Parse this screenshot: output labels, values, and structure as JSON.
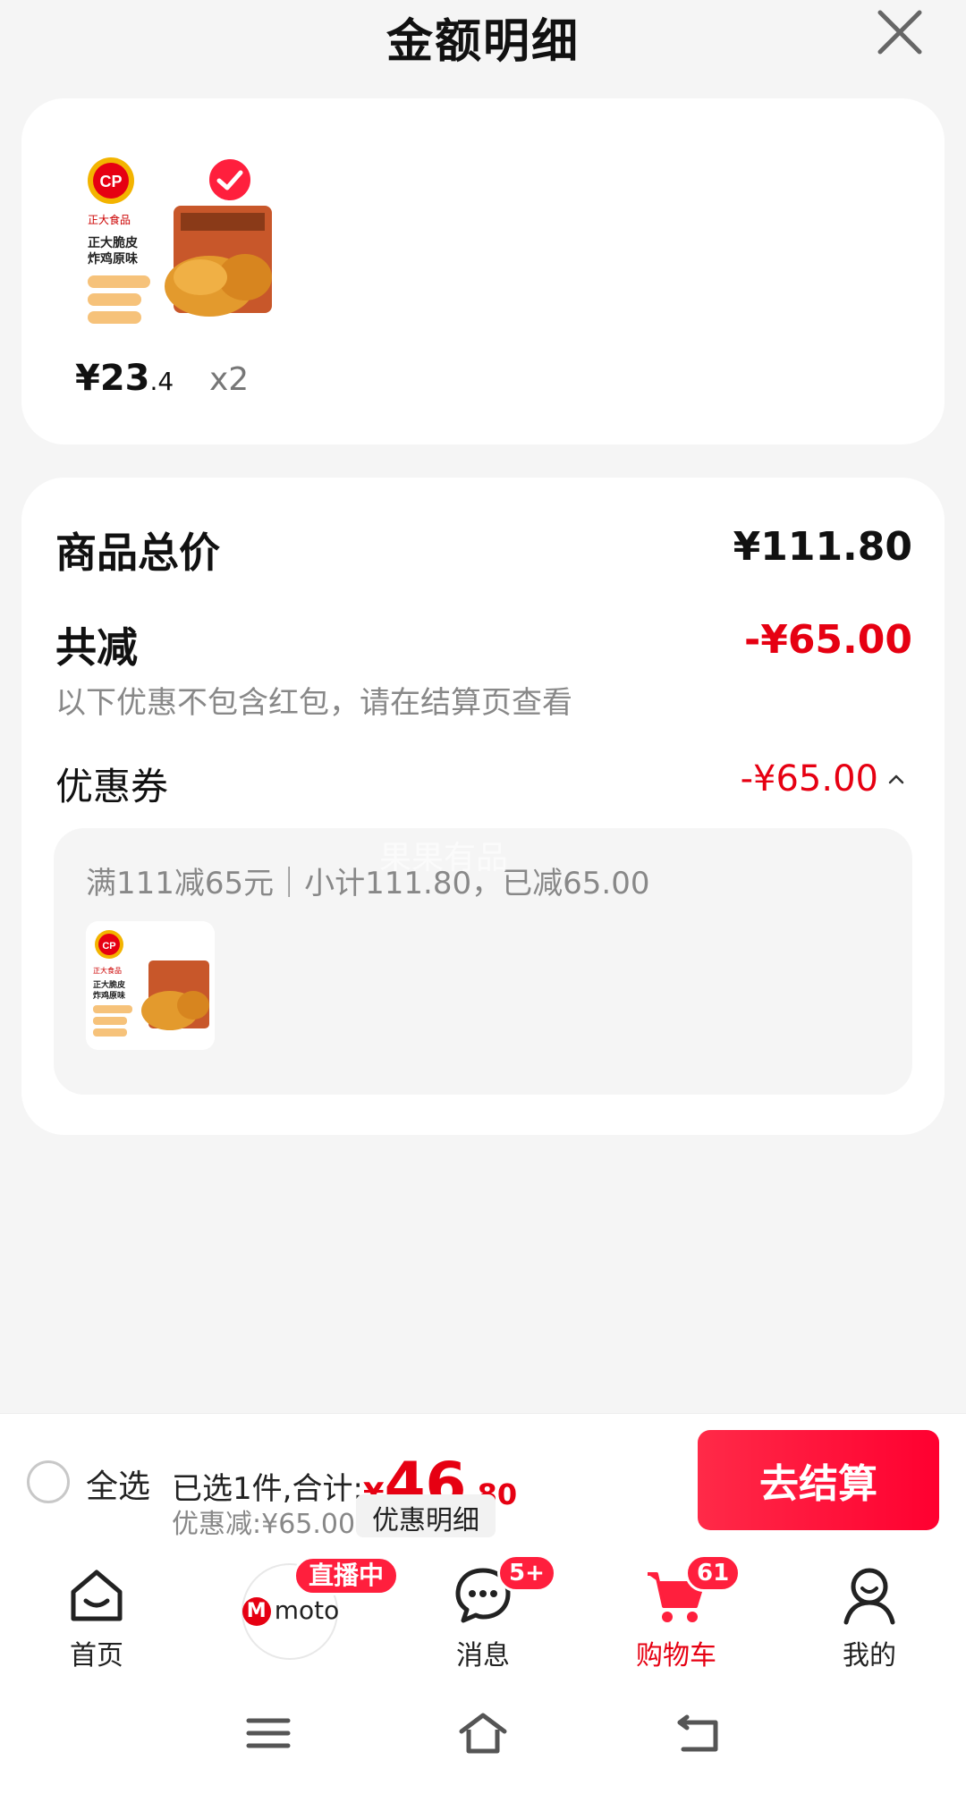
{
  "header": {
    "title": "金额明细",
    "close_icon": "close-icon"
  },
  "product": {
    "image_alt": "正大脆皮炸鸡原味",
    "price_int": "¥23",
    "price_dec": ".4",
    "qty": "x2",
    "selected": true
  },
  "summary_card": {
    "total_label": "商品总价",
    "total_value": "¥111.80",
    "reduce_label": "共减",
    "reduce_value": "-¥65.00",
    "reduce_note": "以下优惠不包含红包，请在结算页查看",
    "coupon_label": "优惠券",
    "coupon_value": "-¥65.00",
    "coupon_rule": "满111减65元｜小计111.80，已减65.00",
    "watermark": "果果有品"
  },
  "checkout": {
    "select_all": "全选",
    "selected_text": "已选1件,合计:",
    "currency": "¥",
    "total_int": "46",
    "total_dec": ".80",
    "discount_text": "优惠减:¥65.00",
    "detail_button": "优惠明细",
    "checkout_button": "去结算"
  },
  "tabbar": {
    "items": [
      {
        "label": "首页",
        "icon": "home-icon"
      },
      {
        "label": "",
        "icon": "moto-live-icon",
        "badge": "直播中",
        "logo_text": "moto"
      },
      {
        "label": "消息",
        "icon": "message-icon",
        "badge": "5+"
      },
      {
        "label": "购物车",
        "icon": "cart-icon",
        "badge": "61",
        "active": true
      },
      {
        "label": "我的",
        "icon": "profile-icon"
      }
    ]
  },
  "colors": {
    "accent": "#e60012",
    "background": "#f5f5f5",
    "card": "#ffffff"
  }
}
